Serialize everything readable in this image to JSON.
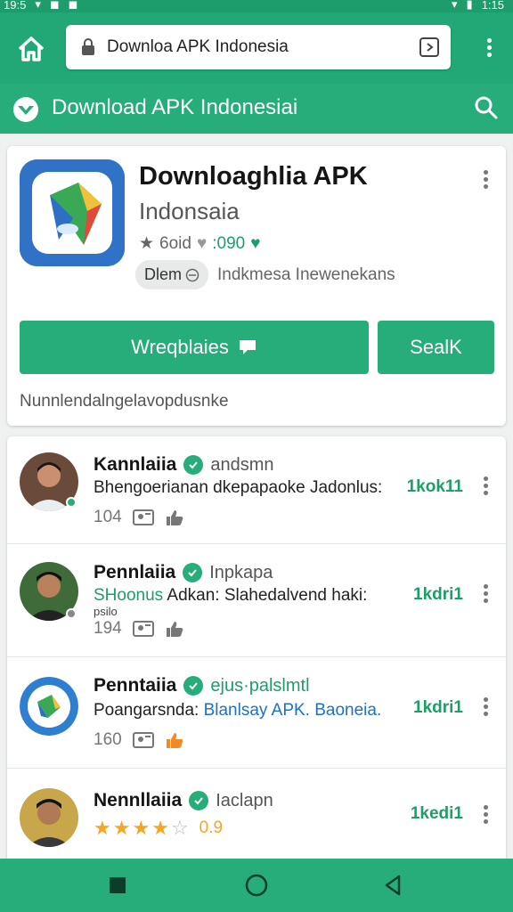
{
  "status_bar": {
    "left_time": "19:5",
    "right_time": "1:15"
  },
  "url_bar": {
    "url": "Downloa APK Indonesia"
  },
  "app_bar": {
    "title": "Download APK Indonesiai"
  },
  "hero": {
    "app_name": "Downloaghlia APK",
    "app_subtitle": "Indonsaia",
    "rating_text": "6oid",
    "downloads_text": ":090",
    "chip_label": "Dlem",
    "chip_description": "Indkmesa Inewenekans",
    "primary_button": "Wreqblaies",
    "secondary_button": "SealK",
    "note": "Nunnlendalngelavopdusnke"
  },
  "posts": [
    {
      "name": "Kannlaiia",
      "tag": "andsmn",
      "text": "Bhengoerianan dkepapaoke Jadonlus:",
      "count": "1kok11",
      "meta": "104",
      "online": "green"
    },
    {
      "name": "Pennlaiia",
      "tag": "Inpkapa",
      "text_green": "SHoonus",
      "text": " Adkan: Slahedalvend haki:",
      "overflow": "psilo",
      "count": "1kdri1",
      "meta": "194",
      "online": "gray"
    },
    {
      "name": "Penntaiia",
      "tag": "ejus·palslmtl",
      "text": "Poangarsnda: ",
      "text_blue": "Blanlsay APK. Baoneia.",
      "count": "1kdri1",
      "meta": "160"
    },
    {
      "name": "Nennllaiia",
      "tag": "Iaclapn",
      "rating_value": "0.9",
      "stars": 4,
      "count": "1kedi1"
    }
  ],
  "colors": {
    "primary": "#27ad79",
    "primary_dark": "#1f9c6b",
    "link_blue": "#1d71c4",
    "star": "#f5a623"
  },
  "icons": [
    "home-icon",
    "lock-icon",
    "tabs-icon",
    "overflow-menu-icon",
    "logo-icon",
    "search-icon",
    "star-icon",
    "heart-icon",
    "message-icon",
    "image-icon",
    "thumbs-up-icon",
    "verified-icon",
    "square-icon",
    "circle-icon",
    "back-icon"
  ]
}
